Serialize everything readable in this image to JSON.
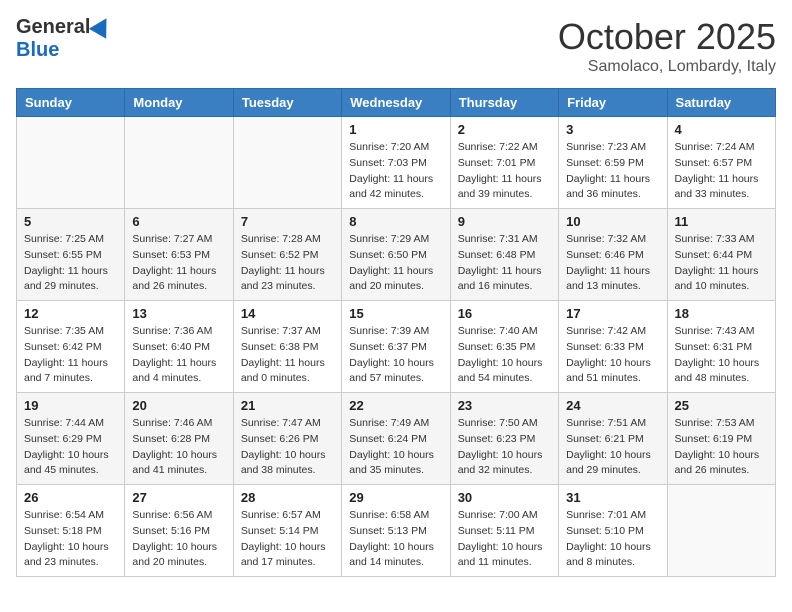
{
  "header": {
    "logo_general": "General",
    "logo_blue": "Blue",
    "month_title": "October 2025",
    "location": "Samolaco, Lombardy, Italy"
  },
  "days_of_week": [
    "Sunday",
    "Monday",
    "Tuesday",
    "Wednesday",
    "Thursday",
    "Friday",
    "Saturday"
  ],
  "weeks": [
    [
      {
        "day": "",
        "info": ""
      },
      {
        "day": "",
        "info": ""
      },
      {
        "day": "",
        "info": ""
      },
      {
        "day": "1",
        "info": "Sunrise: 7:20 AM\nSunset: 7:03 PM\nDaylight: 11 hours\nand 42 minutes."
      },
      {
        "day": "2",
        "info": "Sunrise: 7:22 AM\nSunset: 7:01 PM\nDaylight: 11 hours\nand 39 minutes."
      },
      {
        "day": "3",
        "info": "Sunrise: 7:23 AM\nSunset: 6:59 PM\nDaylight: 11 hours\nand 36 minutes."
      },
      {
        "day": "4",
        "info": "Sunrise: 7:24 AM\nSunset: 6:57 PM\nDaylight: 11 hours\nand 33 minutes."
      }
    ],
    [
      {
        "day": "5",
        "info": "Sunrise: 7:25 AM\nSunset: 6:55 PM\nDaylight: 11 hours\nand 29 minutes."
      },
      {
        "day": "6",
        "info": "Sunrise: 7:27 AM\nSunset: 6:53 PM\nDaylight: 11 hours\nand 26 minutes."
      },
      {
        "day": "7",
        "info": "Sunrise: 7:28 AM\nSunset: 6:52 PM\nDaylight: 11 hours\nand 23 minutes."
      },
      {
        "day": "8",
        "info": "Sunrise: 7:29 AM\nSunset: 6:50 PM\nDaylight: 11 hours\nand 20 minutes."
      },
      {
        "day": "9",
        "info": "Sunrise: 7:31 AM\nSunset: 6:48 PM\nDaylight: 11 hours\nand 16 minutes."
      },
      {
        "day": "10",
        "info": "Sunrise: 7:32 AM\nSunset: 6:46 PM\nDaylight: 11 hours\nand 13 minutes."
      },
      {
        "day": "11",
        "info": "Sunrise: 7:33 AM\nSunset: 6:44 PM\nDaylight: 11 hours\nand 10 minutes."
      }
    ],
    [
      {
        "day": "12",
        "info": "Sunrise: 7:35 AM\nSunset: 6:42 PM\nDaylight: 11 hours\nand 7 minutes."
      },
      {
        "day": "13",
        "info": "Sunrise: 7:36 AM\nSunset: 6:40 PM\nDaylight: 11 hours\nand 4 minutes."
      },
      {
        "day": "14",
        "info": "Sunrise: 7:37 AM\nSunset: 6:38 PM\nDaylight: 11 hours\nand 0 minutes."
      },
      {
        "day": "15",
        "info": "Sunrise: 7:39 AM\nSunset: 6:37 PM\nDaylight: 10 hours\nand 57 minutes."
      },
      {
        "day": "16",
        "info": "Sunrise: 7:40 AM\nSunset: 6:35 PM\nDaylight: 10 hours\nand 54 minutes."
      },
      {
        "day": "17",
        "info": "Sunrise: 7:42 AM\nSunset: 6:33 PM\nDaylight: 10 hours\nand 51 minutes."
      },
      {
        "day": "18",
        "info": "Sunrise: 7:43 AM\nSunset: 6:31 PM\nDaylight: 10 hours\nand 48 minutes."
      }
    ],
    [
      {
        "day": "19",
        "info": "Sunrise: 7:44 AM\nSunset: 6:29 PM\nDaylight: 10 hours\nand 45 minutes."
      },
      {
        "day": "20",
        "info": "Sunrise: 7:46 AM\nSunset: 6:28 PM\nDaylight: 10 hours\nand 41 minutes."
      },
      {
        "day": "21",
        "info": "Sunrise: 7:47 AM\nSunset: 6:26 PM\nDaylight: 10 hours\nand 38 minutes."
      },
      {
        "day": "22",
        "info": "Sunrise: 7:49 AM\nSunset: 6:24 PM\nDaylight: 10 hours\nand 35 minutes."
      },
      {
        "day": "23",
        "info": "Sunrise: 7:50 AM\nSunset: 6:23 PM\nDaylight: 10 hours\nand 32 minutes."
      },
      {
        "day": "24",
        "info": "Sunrise: 7:51 AM\nSunset: 6:21 PM\nDaylight: 10 hours\nand 29 minutes."
      },
      {
        "day": "25",
        "info": "Sunrise: 7:53 AM\nSunset: 6:19 PM\nDaylight: 10 hours\nand 26 minutes."
      }
    ],
    [
      {
        "day": "26",
        "info": "Sunrise: 6:54 AM\nSunset: 5:18 PM\nDaylight: 10 hours\nand 23 minutes."
      },
      {
        "day": "27",
        "info": "Sunrise: 6:56 AM\nSunset: 5:16 PM\nDaylight: 10 hours\nand 20 minutes."
      },
      {
        "day": "28",
        "info": "Sunrise: 6:57 AM\nSunset: 5:14 PM\nDaylight: 10 hours\nand 17 minutes."
      },
      {
        "day": "29",
        "info": "Sunrise: 6:58 AM\nSunset: 5:13 PM\nDaylight: 10 hours\nand 14 minutes."
      },
      {
        "day": "30",
        "info": "Sunrise: 7:00 AM\nSunset: 5:11 PM\nDaylight: 10 hours\nand 11 minutes."
      },
      {
        "day": "31",
        "info": "Sunrise: 7:01 AM\nSunset: 5:10 PM\nDaylight: 10 hours\nand 8 minutes."
      },
      {
        "day": "",
        "info": ""
      }
    ]
  ]
}
